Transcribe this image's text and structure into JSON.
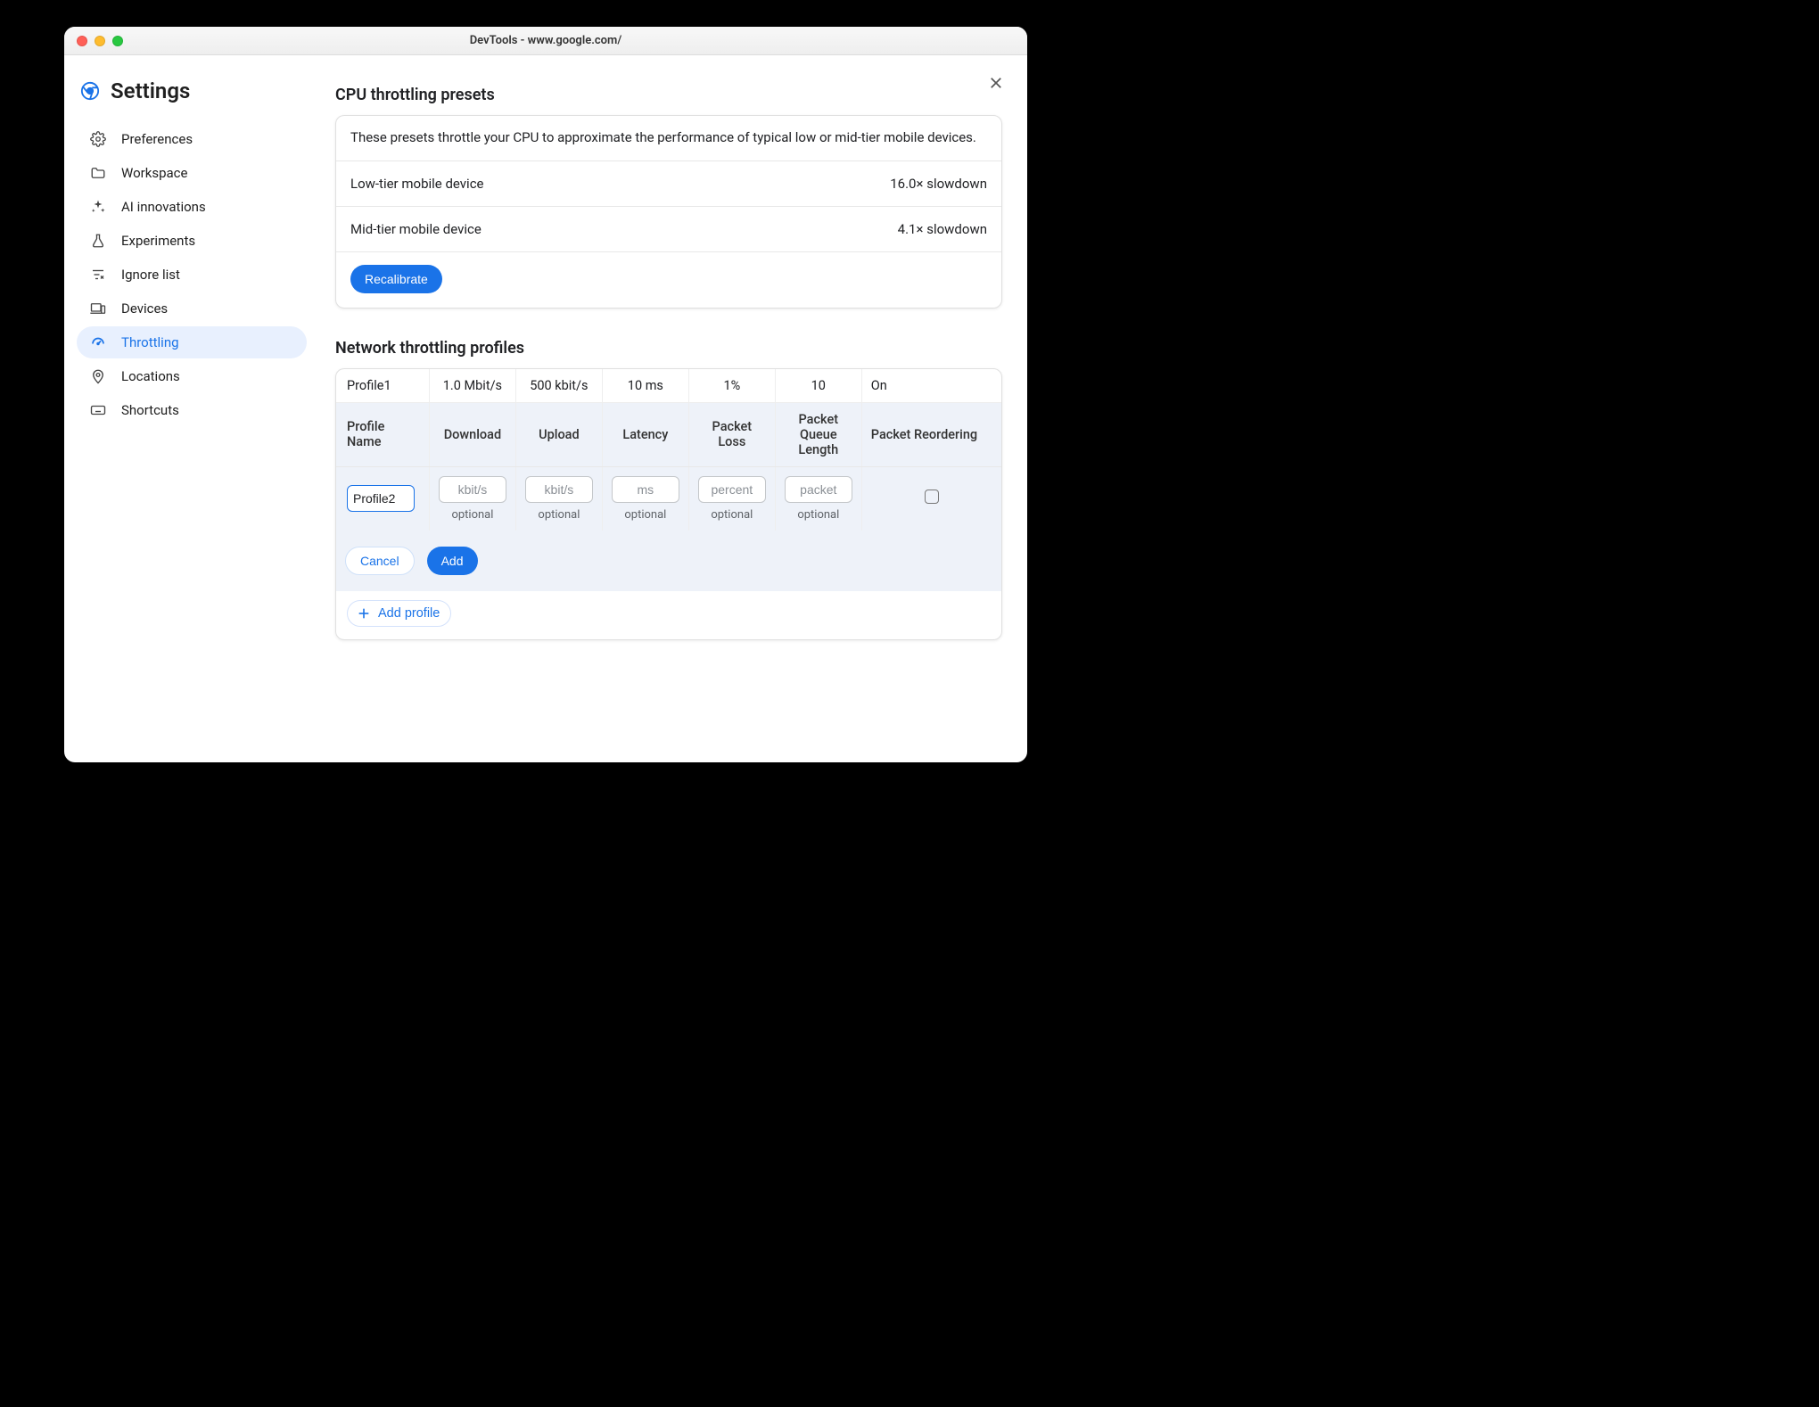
{
  "window_title": "DevTools - www.google.com/",
  "settings_title": "Settings",
  "sidebar": {
    "items": [
      {
        "label": "Preferences"
      },
      {
        "label": "Workspace"
      },
      {
        "label": "AI innovations"
      },
      {
        "label": "Experiments"
      },
      {
        "label": "Ignore list"
      },
      {
        "label": "Devices"
      },
      {
        "label": "Throttling"
      },
      {
        "label": "Locations"
      },
      {
        "label": "Shortcuts"
      }
    ],
    "active_index": 6
  },
  "cpu": {
    "heading": "CPU throttling presets",
    "description": "These presets throttle your CPU to approximate the performance of typical low or mid-tier mobile devices.",
    "rows": [
      {
        "name": "Low-tier mobile device",
        "value": "16.0× slowdown"
      },
      {
        "name": "Mid-tier mobile device",
        "value": "4.1× slowdown"
      }
    ],
    "recalibrate_label": "Recalibrate"
  },
  "net": {
    "heading": "Network throttling profiles",
    "existing": {
      "name": "Profile1",
      "download": "1.0 Mbit/s",
      "upload": "500 kbit/s",
      "latency": "10 ms",
      "packet_loss": "1%",
      "packet_queue": "10",
      "packet_reorder": "On"
    },
    "columns": [
      "Profile Name",
      "Download",
      "Upload",
      "Latency",
      "Packet Loss",
      "Packet Queue Length",
      "Packet Reordering"
    ],
    "edit": {
      "name_value": "Profile2",
      "placeholders": {
        "download": "kbit/s",
        "upload": "kbit/s",
        "latency": "ms",
        "packet_loss": "percent",
        "packet_queue": "packet"
      },
      "optional_label": "optional",
      "cancel_label": "Cancel",
      "add_label": "Add"
    },
    "add_profile_label": "Add profile"
  }
}
